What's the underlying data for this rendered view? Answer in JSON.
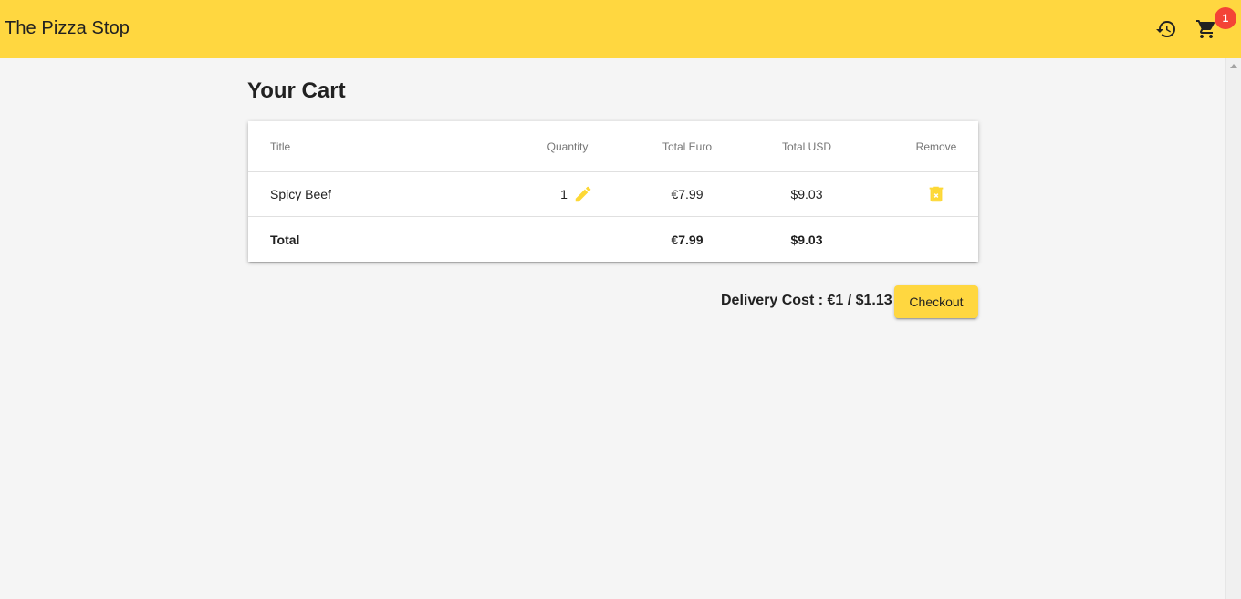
{
  "app": {
    "title": "The Pizza Stop"
  },
  "toolbar": {
    "history_icon": "history-icon",
    "cart_icon": "shopping-cart-icon",
    "cart_badge": "1"
  },
  "page": {
    "title": "Your Cart"
  },
  "table": {
    "headers": {
      "title": "Title",
      "quantity": "Quantity",
      "total_euro": "Total Euro",
      "total_usd": "Total USD",
      "remove": "Remove"
    },
    "rows": [
      {
        "title": "Spicy Beef",
        "quantity": "1",
        "total_euro": "€7.99",
        "total_usd": "$9.03",
        "edit_icon": "pencil-icon",
        "remove_icon": "delete-icon"
      }
    ],
    "total": {
      "label": "Total",
      "total_euro": "€7.99",
      "total_usd": "$9.03"
    }
  },
  "footer": {
    "delivery_text": "Delivery Cost : €1 / $1.13",
    "checkout_label": "Checkout"
  },
  "colors": {
    "accent": "#FFD740",
    "badge": "#f44336",
    "background": "#f5f5f5"
  }
}
